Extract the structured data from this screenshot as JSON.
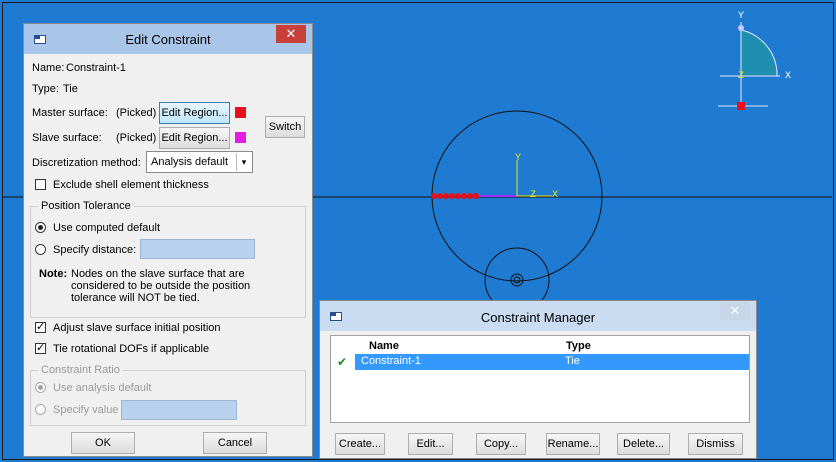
{
  "viewport": {
    "origin_labels": {
      "y": "Y",
      "z": "Z",
      "x": "X"
    },
    "triad": {
      "y": "Y",
      "z": "Z",
      "x": "X"
    }
  },
  "edit_constraint": {
    "title": "Edit Constraint",
    "name_label": "Name:",
    "name_value": "Constraint-1",
    "type_label": "Type:",
    "type_value": "Tie",
    "master_label": "Master surface:",
    "master_state": "(Picked)",
    "master_btn": "Edit Region...",
    "master_color": "#e8101a",
    "slave_label": "Slave surface:",
    "slave_state": "(Picked)",
    "slave_btn": "Edit Region...",
    "slave_color": "#e21ee2",
    "switch_btn": "Switch",
    "discretization_label": "Discretization method:",
    "discretization_value": "Analysis default",
    "exclude_shell_label": "Exclude shell element thickness",
    "exclude_shell_checked": false,
    "position_tolerance": {
      "title": "Position Tolerance",
      "use_computed": "Use computed default",
      "use_computed_selected": true,
      "specify_distance": "Specify distance:",
      "specify_distance_value": "",
      "note_label": "Note:",
      "note_lines": [
        "Nodes on the slave surface that are",
        "considered to be outside the position",
        "tolerance will NOT be tied."
      ]
    },
    "adjust_slave_label": "Adjust slave surface initial position",
    "adjust_slave_checked": true,
    "tie_rotational_label": "Tie rotational DOFs if applicable",
    "tie_rotational_checked": true,
    "constraint_ratio": {
      "title": "Constraint Ratio",
      "use_analysis_default": "Use analysis default",
      "use_analysis_default_selected": true,
      "specify_value": "Specify value",
      "specify_value_value": ""
    },
    "ok_btn": "OK",
    "cancel_btn": "Cancel"
  },
  "constraint_manager": {
    "title": "Constraint Manager",
    "columns": [
      "Name",
      "Type"
    ],
    "rows": [
      {
        "check": "✔",
        "name": "Constraint-1",
        "type": "Tie",
        "selected": true
      }
    ],
    "buttons": [
      "Create...",
      "Edit...",
      "Copy...",
      "Rename...",
      "Delete...",
      "Dismiss"
    ]
  },
  "colors": {
    "viewport_bg": "#1f7ad1",
    "titlebar_active": "#a9c6e8",
    "titlebar_inactive": "#c9dcf2",
    "close_red": "#c7403a",
    "selection": "#3399ff"
  }
}
